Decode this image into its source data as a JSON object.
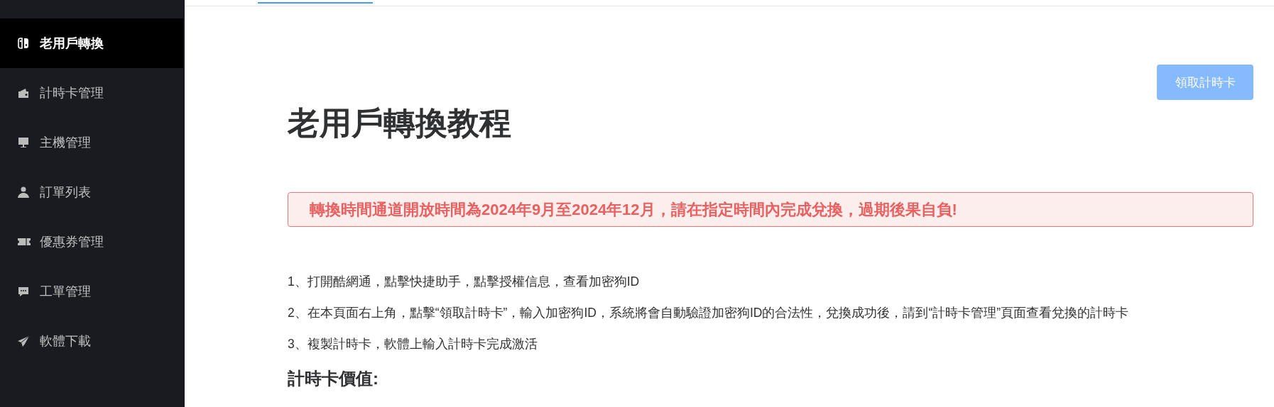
{
  "sidebar": {
    "items": [
      {
        "label": "老用戶轉換",
        "selected": true
      },
      {
        "label": "計時卡管理",
        "selected": false
      },
      {
        "label": "主機管理",
        "selected": false
      },
      {
        "label": "訂單列表",
        "selected": false
      },
      {
        "label": "優惠券管理",
        "selected": false
      },
      {
        "label": "工單管理",
        "selected": false
      },
      {
        "label": "軟體下載",
        "selected": false
      }
    ]
  },
  "toolbar": {
    "button": "領取計時卡"
  },
  "title": "老用戶轉換教程",
  "alert": "轉換時間通道開放時間為2024年9月至2024年12月，請在指定時間內完成兌換，過期後果自負!",
  "steps": [
    "1、打開酷網通，點擊快捷助手，點擊授權信息，查看加密狗ID",
    "2、在本頁面右上角，點擊“領取計時卡”，輸入加密狗ID，系統將會自動驗證加密狗ID的合法性，兌換成功後，請到“計時卡管理”頁面查看兌換的計時卡",
    "3、複製計時卡，軟體上輸入計時卡完成激活"
  ],
  "section_heading": "計時卡價值:"
}
